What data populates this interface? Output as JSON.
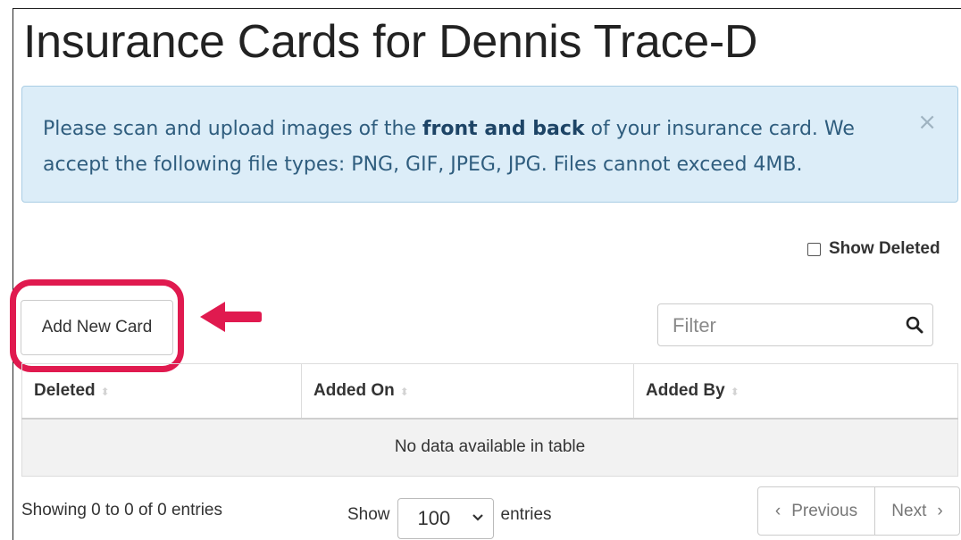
{
  "page": {
    "title": "Insurance Cards for Dennis Trace-D"
  },
  "alert": {
    "text_before": "Please scan and upload images of the ",
    "text_bold": "front and back",
    "text_after": " of your insurance card. We accept the following file types: PNG, GIF, JPEG, JPG. Files cannot exceed 4MB.",
    "close": "×"
  },
  "show_deleted": {
    "label": "Show Deleted",
    "checked": false
  },
  "toolbar": {
    "add_label": "Add New Card"
  },
  "filter": {
    "placeholder": "Filter",
    "value": ""
  },
  "table": {
    "columns": [
      "Deleted",
      "Added On",
      "Added By"
    ],
    "empty_message": "No data available in table",
    "rows": []
  },
  "footer": {
    "info": "Showing 0 to 0 of 0 entries",
    "show_label": "Show",
    "page_length": "100",
    "entries_label": "entries",
    "prev_label": "Previous",
    "next_label": "Next",
    "prev_glyph": "‹",
    "next_glyph": "›"
  },
  "colors": {
    "highlight": "#e01a4f",
    "alert_bg": "#dcedf8",
    "alert_text": "#2f5d7e"
  }
}
